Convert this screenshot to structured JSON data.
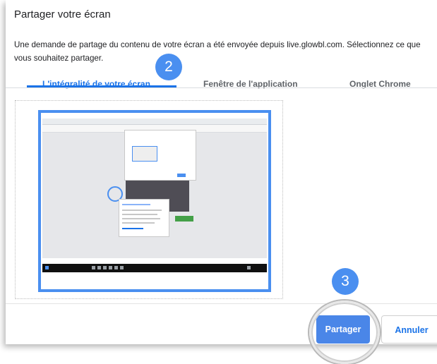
{
  "dialog": {
    "title": "Partager votre écran",
    "description": "Une demande de partage du contenu de votre écran a été envoyée depuis live.glowbl.com. Sélectionnez ce que vous souhaitez partager."
  },
  "tabs": [
    {
      "label": "L'intégralité de votre écran",
      "active": true
    },
    {
      "label": "Fenêtre de l'application",
      "active": false
    },
    {
      "label": "Onglet Chrome",
      "active": false
    }
  ],
  "buttons": {
    "share_label": "Partager",
    "cancel_label": "Annuler"
  },
  "annotations": {
    "step_tabs": "2",
    "step_share": "3"
  },
  "colors": {
    "accent": "#1a73e8",
    "badge": "#4a8ff0",
    "primary_button": "#4a86e8",
    "selection_border": "#4a8ff0"
  },
  "icons": {
    "screen_thumbnail": "screen-thumbnail-icon"
  }
}
